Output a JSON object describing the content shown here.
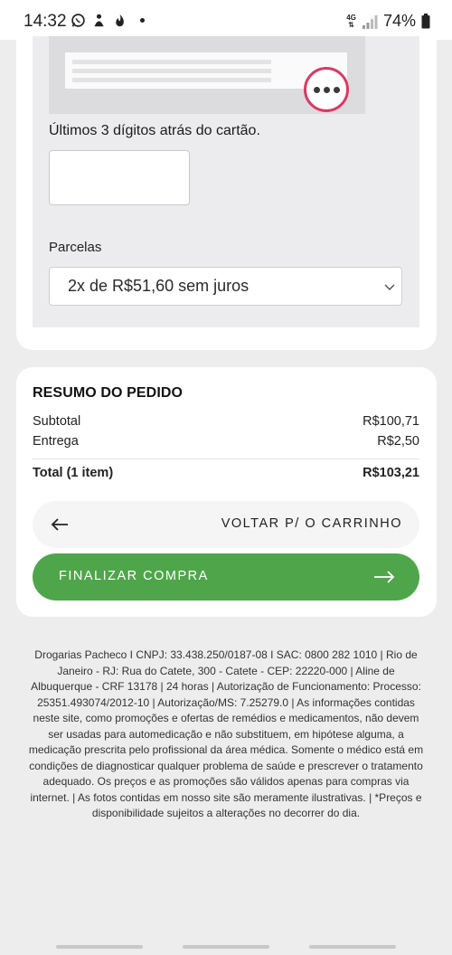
{
  "status_bar": {
    "time": "14:32",
    "icons": [
      "whatsapp-icon",
      "app-icon",
      "fire-icon"
    ],
    "network": "4G",
    "battery": "74%"
  },
  "payment": {
    "cvv_label": "Últimos 3 dígitos atrás do cartão.",
    "cvv_value": "",
    "installments_label": "Parcelas",
    "installments_selected": "2x de R$51,60 sem juros"
  },
  "summary": {
    "title": "RESUMO DO PEDIDO",
    "subtotal_label": "Subtotal",
    "subtotal_value": "R$100,71",
    "delivery_label": "Entrega",
    "delivery_value": "R$2,50",
    "total_label": "Total (1 item)",
    "total_value": "R$103,21",
    "back_button": "VOLTAR P/ O CARRINHO",
    "finish_button": "FINALIZAR COMPRA"
  },
  "footer": {
    "text": "Drogarias Pacheco I CNPJ: 33.438.250/0187-08 I SAC: 0800 282 1010 | Rio de Janeiro - RJ: Rua do Catete, 300 - Catete - CEP: 22220-000 | Aline de Albuquerque - CRF 13178 | 24 horas | Autorização de Funcionamento: Processo: 25351.493074/2012-10 | Autorização/MS: 7.25279.0 | As informações contidas neste site, como promoções e ofertas de remédios e medicamentos, não devem ser usadas para automedicação e não substituem, em hipótese alguma, a medicação prescrita pelo profissional da área médica. Somente o médico está em condições de diagnosticar qualquer problema de saúde e prescrever o tratamento adequado. Os preços e as promoções são válidos apenas para compras via internet. | As fotos contidas em nosso site são meramente ilustrativas. | *Preços e disponibilidade sujeitos a alterações no decorrer do dia."
  },
  "colors": {
    "accent_green": "#4fa64a",
    "cvv_highlight": "#d93a64"
  }
}
